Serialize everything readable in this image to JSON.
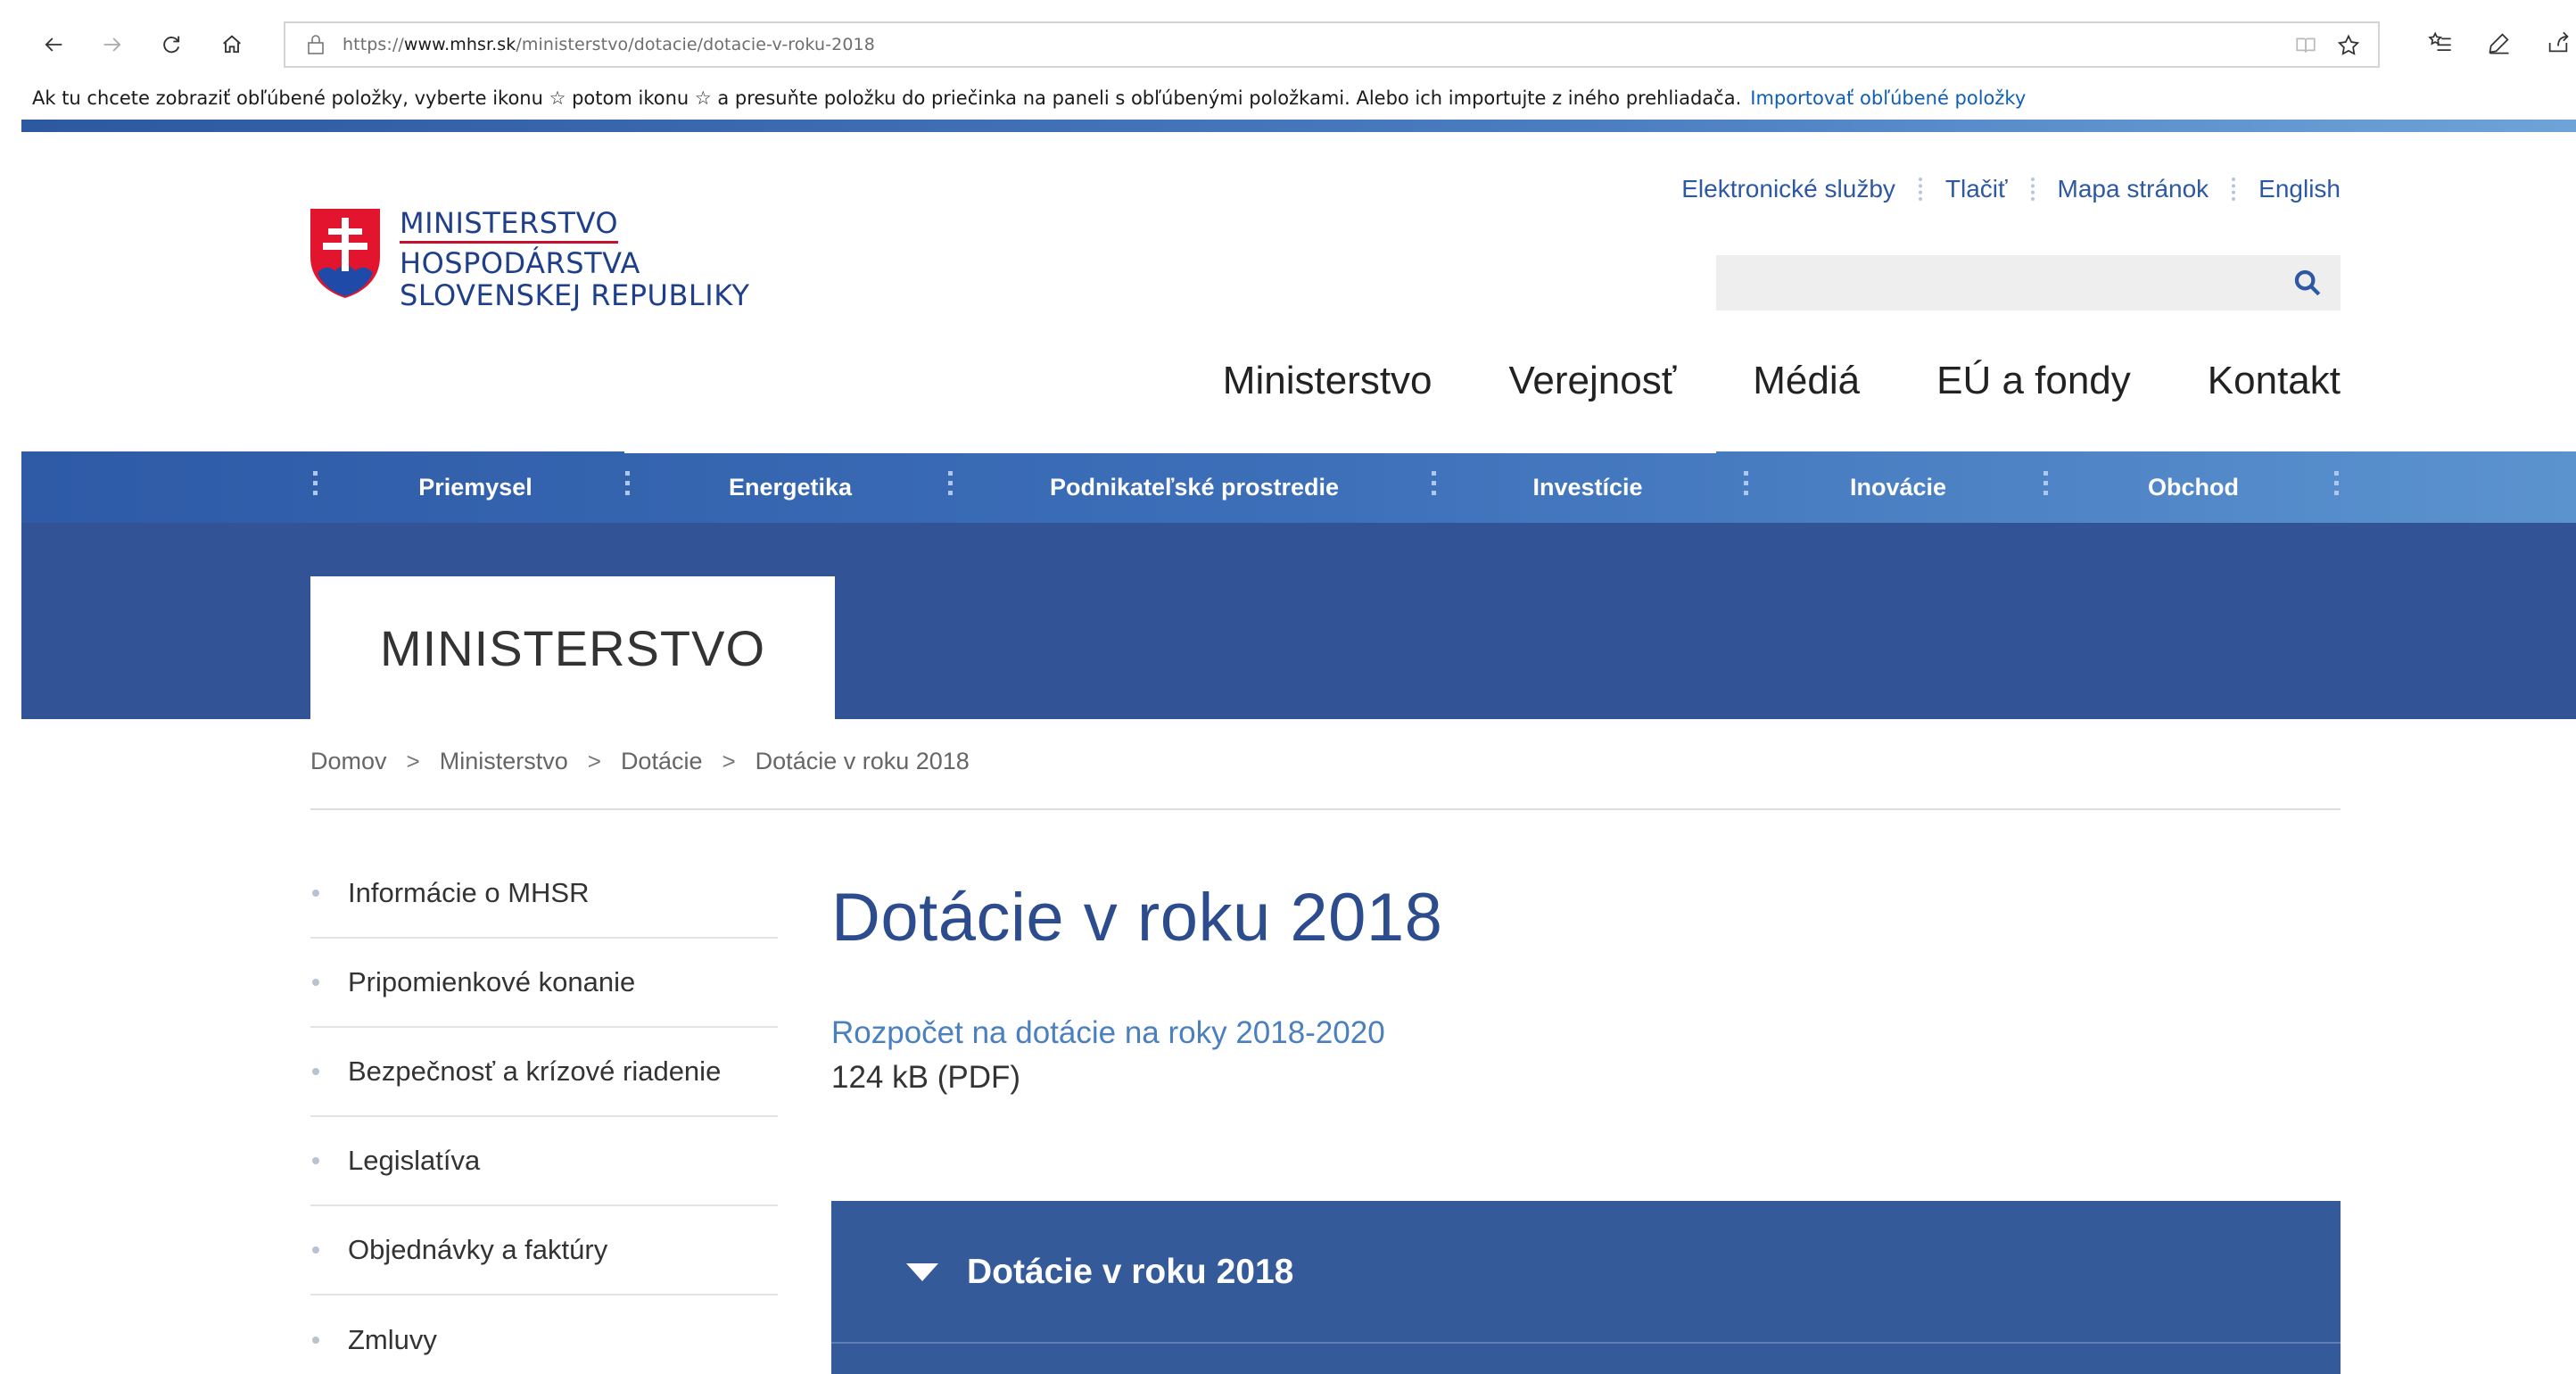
{
  "browser": {
    "url_prefix": "https://",
    "url_host": "www.mhsr.sk",
    "url_path": "/ministerstvo/dotacie/dotacie-v-roku-2018",
    "favorites_bar": {
      "message": "Ak tu chcete zobraziť obľúbené položky, vyberte ikonu ☆ potom ikonu ☆ a presuňte položku do priečinka na paneli s obľúbenými položkami. Alebo ich importujte z iného prehliadača.",
      "import_link": "Importovať obľúbené položky"
    }
  },
  "site": {
    "logo": {
      "line1": "MINISTERSTVO",
      "line2": "HOSPODÁRSTVA",
      "line3": "SLOVENSKEJ REPUBLIKY"
    },
    "utility_links": [
      "Elektronické služby",
      "Tlačiť",
      "Mapa stránok",
      "English"
    ],
    "search": {
      "placeholder": ""
    },
    "main_nav": [
      "Ministerstvo",
      "Verejnosť",
      "Médiá",
      "EÚ a fondy",
      "Kontakt"
    ],
    "category_bar": [
      "Priemysel",
      "Energetika",
      "Podnikateľské prostredie",
      "Investície",
      "Inovácie",
      "Obchod"
    ],
    "hero_title": "MINISTERSTVO",
    "breadcrumb": [
      "Domov",
      "Ministerstvo",
      "Dotácie",
      "Dotácie v roku 2018"
    ],
    "breadcrumb_separator": ">",
    "side_menu": [
      "Informácie o MHSR",
      "Pripomienkové konanie",
      "Bezpečnosť a krízové riadenie",
      "Legislatíva",
      "Objednávky a faktúry",
      "Zmluvy"
    ],
    "content": {
      "title": "Dotácie v roku 2018",
      "document_link": "Rozpočet na dotácie na roky 2018-2020",
      "document_meta": "124 kB (PDF)",
      "accordion_title": "Dotácie v roku 2018"
    }
  },
  "colors": {
    "brand_blue": "#2d58a2",
    "hero_blue": "#325496",
    "accordion_blue": "#345a9a",
    "link_blue": "#4a7fc0",
    "flag_red": "#c8102e"
  }
}
